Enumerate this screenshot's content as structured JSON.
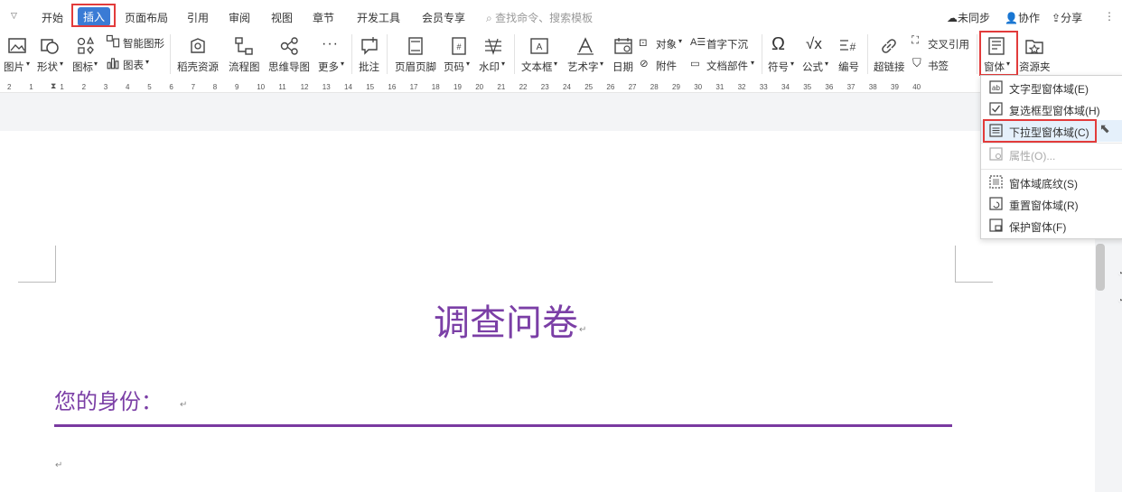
{
  "tabs": {
    "start": "开始",
    "insert": "插入",
    "page_layout": "页面布局",
    "references": "引用",
    "review": "审阅",
    "view": "视图",
    "section": "章节",
    "developer": "开发工具",
    "member": "会员专享"
  },
  "search": {
    "placeholder": "查找命令、搜索模板"
  },
  "top_right": {
    "sync": "未同步",
    "collab": "协作",
    "share": "分享"
  },
  "ribbon": {
    "picture": "图片",
    "shape": "形状",
    "icon": "图标",
    "smart_graphic": "智能图形",
    "chart": "图表",
    "docer": "稻壳资源",
    "flowchart": "流程图",
    "mindmap": "思维导图",
    "more": "更多",
    "comment": "批注",
    "header_footer": "页眉页脚",
    "page_number": "页码",
    "watermark": "水印",
    "textbox": "文本框",
    "wordart": "艺术字",
    "date": "日期",
    "object": "对象",
    "attachment": "附件",
    "drop_cap": "首字下沉",
    "doc_parts": "文档部件",
    "symbol": "符号",
    "formula": "公式",
    "numbering": "编号",
    "hyperlink": "超链接",
    "cross_ref": "交叉引用",
    "bookmark": "书签",
    "form": "窗体",
    "resources": "资源夹"
  },
  "ruler": [
    "2",
    "1",
    "1",
    "2",
    "3",
    "4",
    "5",
    "6",
    "7",
    "8",
    "9",
    "10",
    "11",
    "12",
    "13",
    "14",
    "15",
    "16",
    "17",
    "18",
    "19",
    "20",
    "21",
    "22",
    "23",
    "24",
    "25",
    "26",
    "27",
    "28",
    "29",
    "30",
    "31",
    "32",
    "33",
    "34",
    "35",
    "36",
    "37",
    "38",
    "39",
    "40"
  ],
  "document": {
    "title": "调查问卷",
    "heading": "您的身份：",
    "para_mark": "↵"
  },
  "form_menu": {
    "items": [
      "文字型窗体域(E)",
      "复选框型窗体域(H)",
      "下拉型窗体域(C)",
      "属性(O)...",
      "窗体域底纹(S)",
      "重置窗体域(R)",
      "保护窗体(F)"
    ]
  },
  "colors": {
    "accent": "#3a7bd5",
    "highlight": "#e23b3b",
    "heading": "#7b3fa6"
  }
}
